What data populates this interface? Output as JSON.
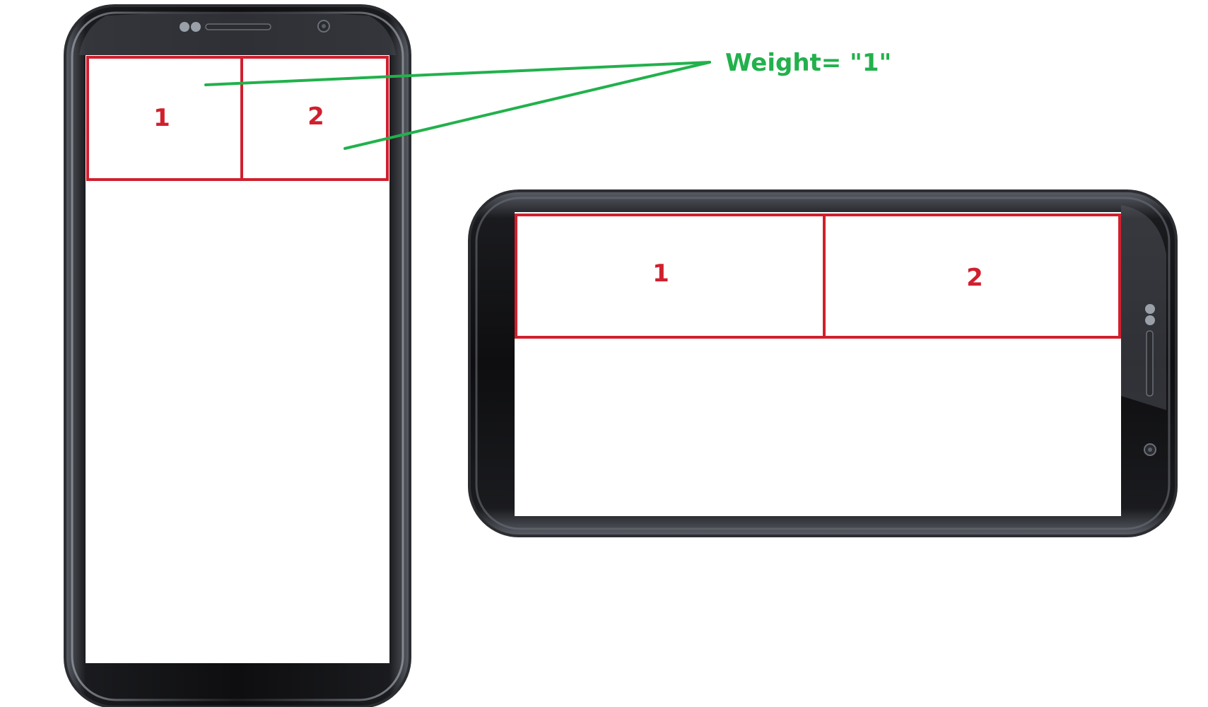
{
  "annotation": {
    "text": "Weight= \"1\"",
    "color": "#22b14c"
  },
  "portrait_phone": {
    "cells": [
      {
        "label": "1"
      },
      {
        "label": "2"
      }
    ]
  },
  "landscape_phone": {
    "cells": [
      {
        "label": "1"
      },
      {
        "label": "2"
      }
    ]
  },
  "colors": {
    "phone_body": "#141416",
    "phone_bezel": "#3a3d42",
    "screen": "#ffffff",
    "cell_border": "#d0202e",
    "cell_text": "#d0202e",
    "callout_line": "#22b14c"
  },
  "icons": [
    "camera-dot-icon",
    "speaker-grille-icon",
    "sensor-dots-icon"
  ]
}
